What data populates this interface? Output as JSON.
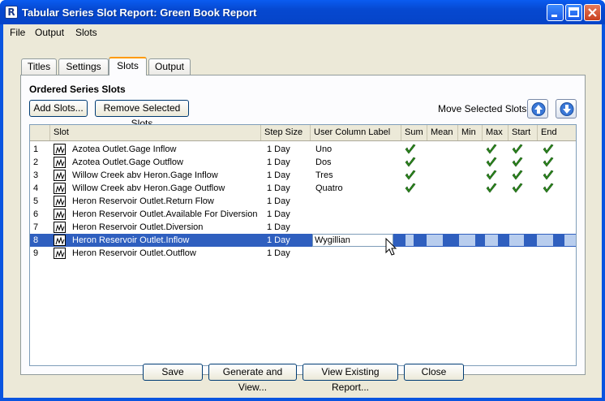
{
  "window": {
    "title": "Tabular Series Slot Report: Green Book Report",
    "controls": [
      "minimize",
      "maximize",
      "close"
    ]
  },
  "menu": [
    "File",
    "Output",
    "Slots"
  ],
  "tabs": [
    {
      "label": "Titles",
      "active": false
    },
    {
      "label": "Settings",
      "active": false
    },
    {
      "label": "Slots",
      "active": true
    },
    {
      "label": "Output",
      "active": false
    }
  ],
  "panel": {
    "heading": "Ordered Series Slots",
    "add_button": "Add Slots...",
    "remove_button": "Remove Selected Slots",
    "move_label": "Move Selected Slots:"
  },
  "table": {
    "columns": [
      "",
      "Slot",
      "Step Size",
      "User Column Label",
      "Sum",
      "Mean",
      "Min",
      "Max",
      "Start",
      "End"
    ],
    "rows": [
      {
        "num": "1",
        "slot": "Azotea Outlet.Gage Inflow",
        "step": "1 Day",
        "label": "Uno",
        "sum": true,
        "mean": false,
        "min": false,
        "max": true,
        "start": true,
        "end": true
      },
      {
        "num": "2",
        "slot": "Azotea Outlet.Gage Outflow",
        "step": "1 Day",
        "label": "Dos",
        "sum": true,
        "mean": false,
        "min": false,
        "max": true,
        "start": true,
        "end": true
      },
      {
        "num": "3",
        "slot": "Willow Creek abv Heron.Gage Inflow",
        "step": "1 Day",
        "label": "Tres",
        "sum": true,
        "mean": false,
        "min": false,
        "max": true,
        "start": true,
        "end": true
      },
      {
        "num": "4",
        "slot": "Willow Creek abv Heron.Gage Outflow",
        "step": "1 Day",
        "label": "Quatro",
        "sum": true,
        "mean": false,
        "min": false,
        "max": true,
        "start": true,
        "end": true
      },
      {
        "num": "5",
        "slot": "Heron Reservoir Outlet.Return Flow",
        "step": "1 Day",
        "label": "",
        "sum": false,
        "mean": false,
        "min": false,
        "max": false,
        "start": false,
        "end": false
      },
      {
        "num": "6",
        "slot": "Heron Reservoir Outlet.Available For Diversion",
        "step": "1 Day",
        "label": "",
        "sum": false,
        "mean": false,
        "min": false,
        "max": false,
        "start": false,
        "end": false
      },
      {
        "num": "7",
        "slot": "Heron Reservoir Outlet.Diversion",
        "step": "1 Day",
        "label": "",
        "sum": false,
        "mean": false,
        "min": false,
        "max": false,
        "start": false,
        "end": false
      },
      {
        "num": "8",
        "slot": "Heron Reservoir Outlet.Inflow",
        "step": "1 Day",
        "label": "Wygillian",
        "sum": false,
        "mean": false,
        "min": false,
        "max": false,
        "start": false,
        "end": false,
        "selected": true,
        "editing": true
      },
      {
        "num": "9",
        "slot": "Heron Reservoir Outlet.Outflow",
        "step": "1 Day",
        "label": "",
        "sum": false,
        "mean": false,
        "min": false,
        "max": false,
        "start": false,
        "end": false
      }
    ]
  },
  "footer": {
    "save": "Save",
    "generate": "Generate and View...",
    "view_existing": "View Existing Report...",
    "close": "Close"
  },
  "colors": {
    "selection": "#2f5fbf",
    "check": "#2e8b1e",
    "titlebar": "#0a55e0"
  }
}
